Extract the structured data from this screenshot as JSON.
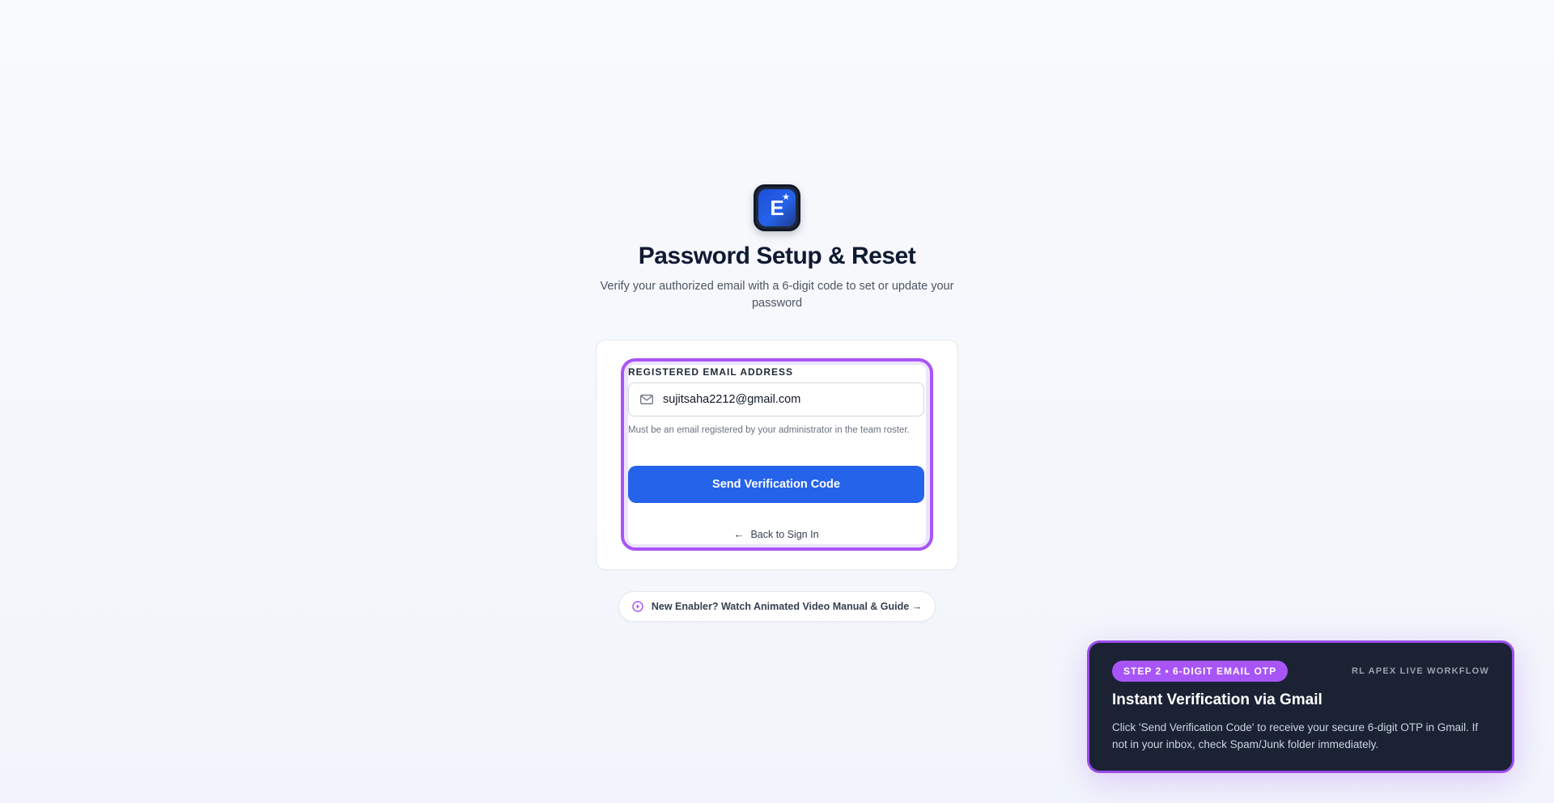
{
  "header": {
    "logo_letter": "E",
    "title": "Password Setup & Reset",
    "subtitle": "Verify your authorized email with a 6-digit code to set or update your password"
  },
  "form": {
    "email_label": "REGISTERED EMAIL ADDRESS",
    "email_value": "sujitsaha2212@gmail.com",
    "help_text": "Must be an email registered by your administrator in the team roster.",
    "send_button": "Send Verification Code",
    "back_link": "Back to Sign In"
  },
  "guide": {
    "label": "New Enabler? Watch Animated Video Manual & Guide →"
  },
  "tour": {
    "step_badge": "STEP 2 • 6-DIGIT EMAIL OTP",
    "brand": "RL APEX LIVE WORKFLOW",
    "title": "Instant Verification via Gmail",
    "description": "Click 'Send Verification Code' to receive your secure 6-digit OTP in Gmail. If not in your inbox, check Spam/Junk folder immediately."
  },
  "colors": {
    "primary": "#2563eb",
    "highlight": "#a855f7",
    "tour_bg": "#1a2234"
  }
}
